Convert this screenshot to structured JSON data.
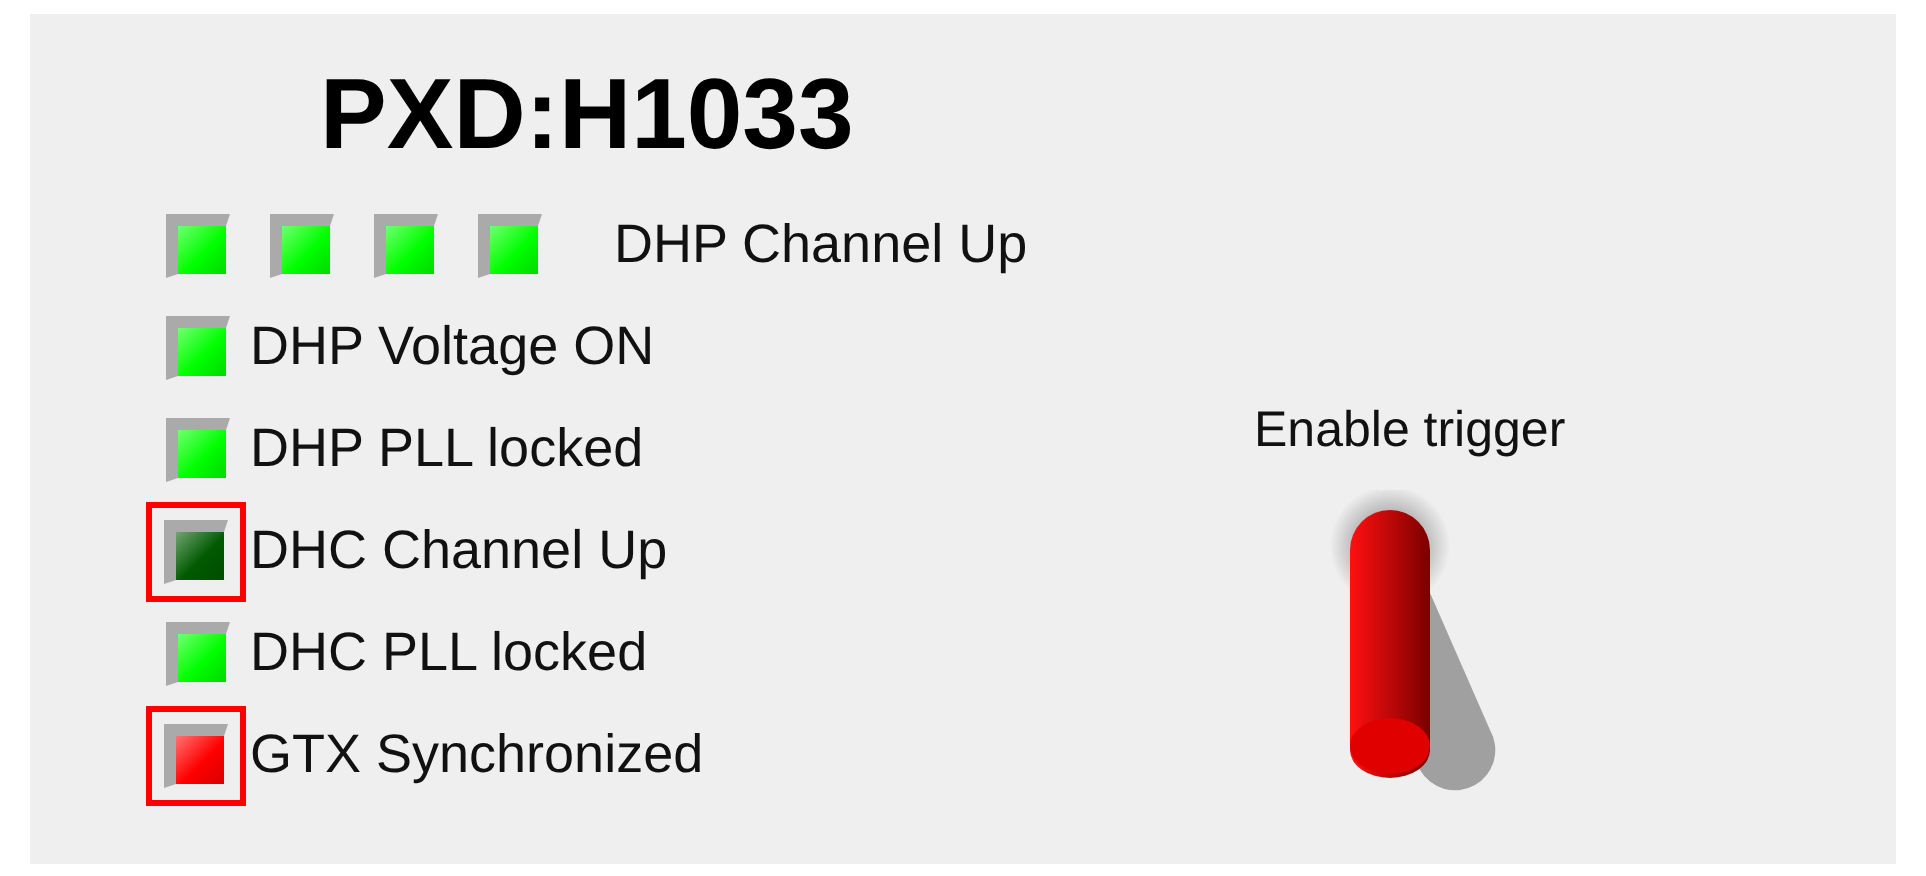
{
  "title": "PXD:H1033",
  "indicators": [
    {
      "label": "DHP Channel Up",
      "leds": [
        {
          "color": "#00ff00",
          "alarm": false
        },
        {
          "color": "#00ff00",
          "alarm": false
        },
        {
          "color": "#00ff00",
          "alarm": false
        },
        {
          "color": "#00ff00",
          "alarm": false
        }
      ]
    },
    {
      "label": "DHP Voltage ON",
      "leds": [
        {
          "color": "#00ff00",
          "alarm": false
        }
      ]
    },
    {
      "label": "DHP PLL locked",
      "leds": [
        {
          "color": "#00ff00",
          "alarm": false
        }
      ]
    },
    {
      "label": "DHC Channel Up",
      "leds": [
        {
          "color": "#005a00",
          "alarm": true
        }
      ]
    },
    {
      "label": "DHC PLL locked",
      "leds": [
        {
          "color": "#00ff00",
          "alarm": false
        }
      ]
    },
    {
      "label": "GTX Synchronized",
      "leds": [
        {
          "color": "#ff0000",
          "alarm": true
        }
      ]
    }
  ],
  "toggle": {
    "label": "Enable trigger",
    "on": true
  }
}
